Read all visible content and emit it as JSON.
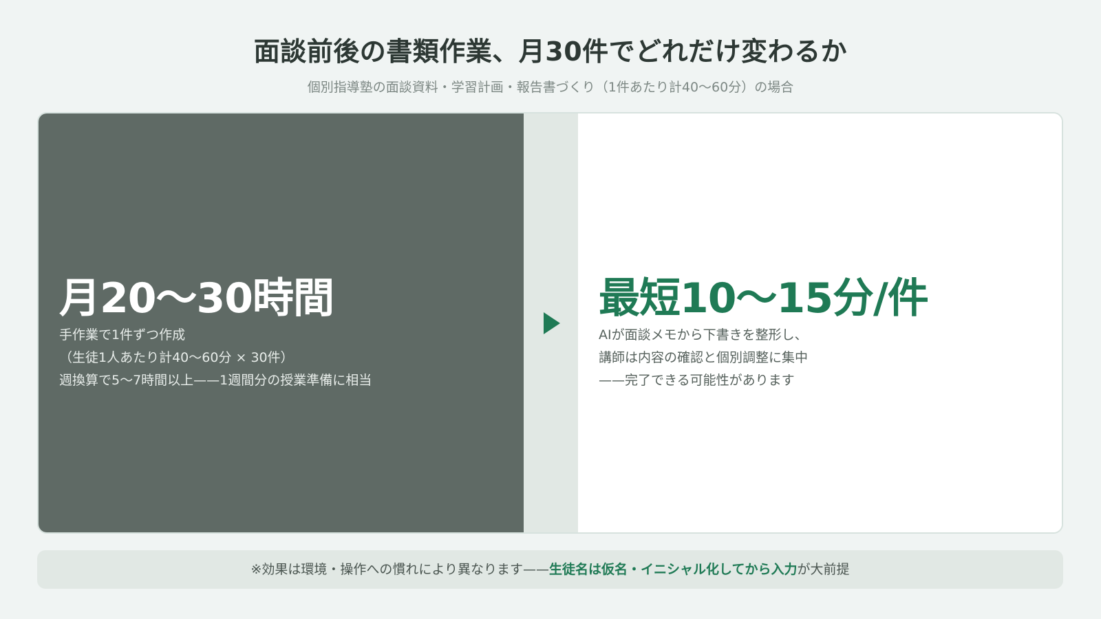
{
  "header": {
    "title": "面談前後の書類作業、月30件でどれだけ変わるか",
    "subtitle": "個別指導塾の面談資料・学習計画・報告書づくり（1件あたり計40〜60分）の場合"
  },
  "before": {
    "headline": "月20〜30時間",
    "lines": [
      "手作業で1件ずつ作成",
      "（生徒1人あたり計40〜60分 × 30件）",
      "週換算で5〜7時間以上——1週間分の授業準備に相当"
    ]
  },
  "after": {
    "headline": "最短10〜15分/件",
    "lines": [
      "AIが面談メモから下書きを整形し、",
      "講師は内容の確認と個別調整に集中",
      "——完了できる可能性があります"
    ]
  },
  "note": {
    "prefix": "※効果は環境・操作への慣れにより異なります——",
    "emphasis": "生徒名は仮名・イニシャル化してから入力",
    "suffix": "が大前提"
  },
  "icons": {
    "arrow": "play-triangle-icon"
  },
  "colors": {
    "accent": "#1f7a55",
    "before_bg": "#5f6a65",
    "page_bg": "#f0f4f3"
  }
}
